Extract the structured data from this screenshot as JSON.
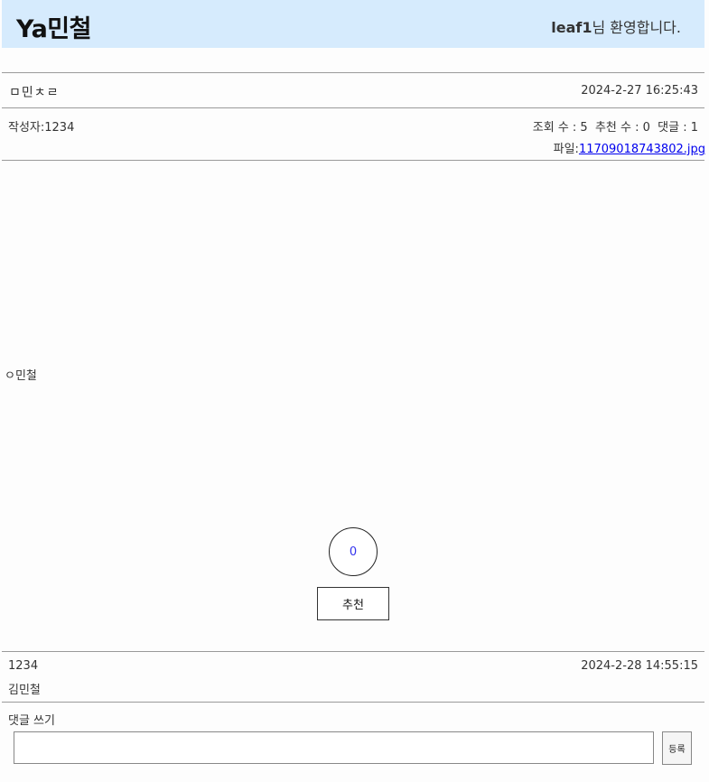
{
  "header": {
    "logo": "Ya민철",
    "username": "leaf1",
    "welcome_suffix": "님 환영합니다."
  },
  "post": {
    "title": "ㅁ민ㅊㄹ",
    "date": "2024-2-27 16:25:43",
    "author_label": "작성자:",
    "author": "1234",
    "stats": "조회 수 : 5  추천 수 : 0  댓글 : 1",
    "file_label": "파일:",
    "file_name": "11709018743802.jpg",
    "content": "ㅇ민철"
  },
  "recommend": {
    "count": "0",
    "button_label": "추천"
  },
  "comments": [
    {
      "author": "1234",
      "date": "2024-2-28 14:55:15",
      "text": "김민철"
    }
  ],
  "comment_form": {
    "label": "댓글 쓰기",
    "input_value": "",
    "submit_label": "등록"
  }
}
